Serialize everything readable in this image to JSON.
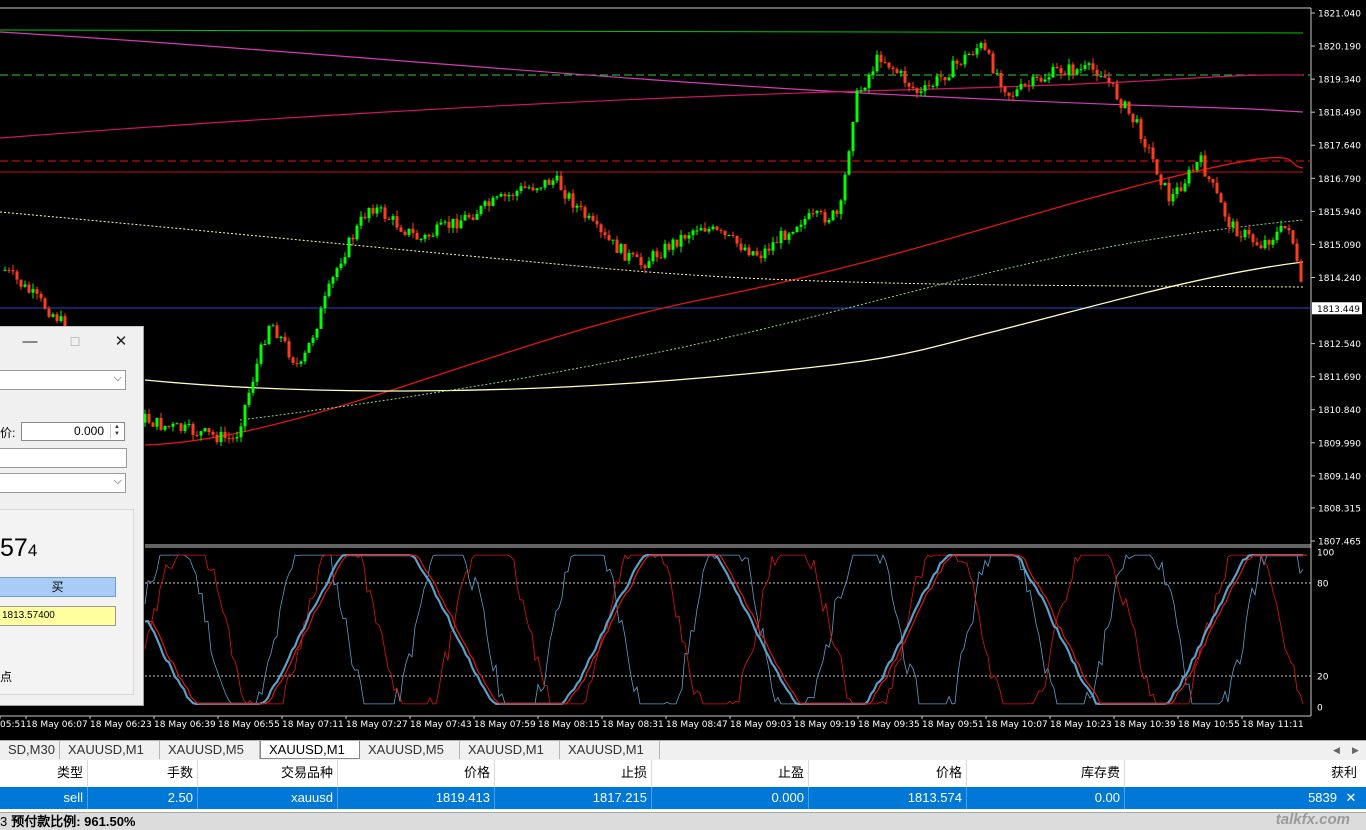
{
  "chart": {
    "price_labels": [
      "1821.040",
      "1820.190",
      "1819.340",
      "1818.490",
      "1817.640",
      "1816.790",
      "1815.940",
      "1815.090",
      "1814.240",
      "1813.449",
      "1812.540",
      "1811.690",
      "1810.840",
      "1809.990",
      "1809.140",
      "1808.315",
      "1807.465"
    ],
    "current_price": "1813.449",
    "osc_labels": [
      "100",
      "80",
      "20",
      "0"
    ],
    "time_labels": [
      "05:51",
      "18 May 06:07",
      "18 May 06:23",
      "18 May 06:39",
      "18 May 06:55",
      "18 May 07:11",
      "18 May 07:27",
      "18 May 07:43",
      "18 May 07:59",
      "18 May 08:15",
      "18 May 08:31",
      "18 May 08:47",
      "18 May 09:03",
      "18 May 09:19",
      "18 May 09:35",
      "18 May 09:51",
      "18 May 10:07",
      "18 May 10:23",
      "18 May 10:39",
      "18 May 10:55",
      "18 May 11:11"
    ],
    "colors": {
      "bull": "#00ff00",
      "bear": "#ff3c1e",
      "ma_fast": "#32cd32",
      "ma_red": "#e01414",
      "ma_yellow": "#ffffc0",
      "bid_line": "#1e50c8",
      "magenta": "#d23cb4",
      "stoch_main": "#5aa0c8",
      "stoch_signal": "#e01414"
    }
  },
  "dialog": {
    "minimize_icon": "—",
    "maximize_icon": "☐",
    "close_icon": "✕",
    "price_label": "价:",
    "price_value": "0.000",
    "big_price_main": "57",
    "big_price_small": "4",
    "buy_label": "买",
    "buy_price": "1813.57400",
    "points_label": "点"
  },
  "tabs": [
    "SD,M30",
    "XAUUSD,M1",
    "XAUUSD,M5",
    "XAUUSD,M1",
    "XAUUSD,M5",
    "XAUUSD,M1",
    "XAUUSD,M1"
  ],
  "table": {
    "headers": [
      "类型",
      "手数",
      "交易品种",
      "价格",
      "止损",
      "止盈",
      "价格",
      "库存费",
      "获利"
    ],
    "row": [
      "sell",
      "2.50",
      "xauusd",
      "1819.413",
      "1817.215",
      "0.000",
      "1813.574",
      "0.00",
      "5839"
    ],
    "close_icon": "✕"
  },
  "status": {
    "text": "预付款比例: 961.50%",
    "prefix": "3",
    "watermark": "talkfx.com"
  }
}
